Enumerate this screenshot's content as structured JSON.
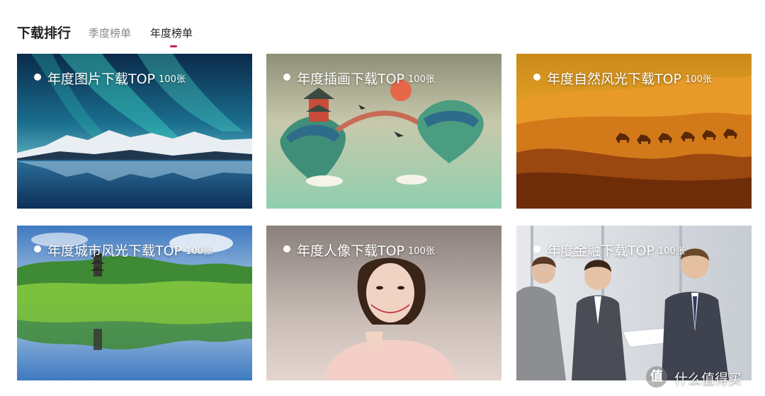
{
  "section": {
    "title": "下载排行",
    "tabs": [
      {
        "label": "季度榜单",
        "active": false
      },
      {
        "label": "年度榜单",
        "active": true
      }
    ],
    "accent_color": "#c8264a"
  },
  "cards": [
    {
      "title": "年度图片下载TOP",
      "count": "100张",
      "image": "aurora-over-snowy-mountains-lake"
    },
    {
      "title": "年度插画下载TOP",
      "count": "100张",
      "image": "floating-islands-pavilion-bridge-illustration"
    },
    {
      "title": "年度自然风光下载TOP",
      "count": "100张",
      "image": "desert-dunes-camel-caravan"
    },
    {
      "title": "年度城市风光下载TOP",
      "count": "100张",
      "image": "lake-pagoda-reflection"
    },
    {
      "title": "年度人像下载TOP",
      "count": "100张",
      "image": "smiling-woman-portrait"
    },
    {
      "title": "年度金融下载TOP",
      "count": "100张",
      "image": "business-people-with-tablet"
    }
  ],
  "watermark": {
    "logo_icon": "值-logo-icon",
    "text": "什么值得买"
  }
}
